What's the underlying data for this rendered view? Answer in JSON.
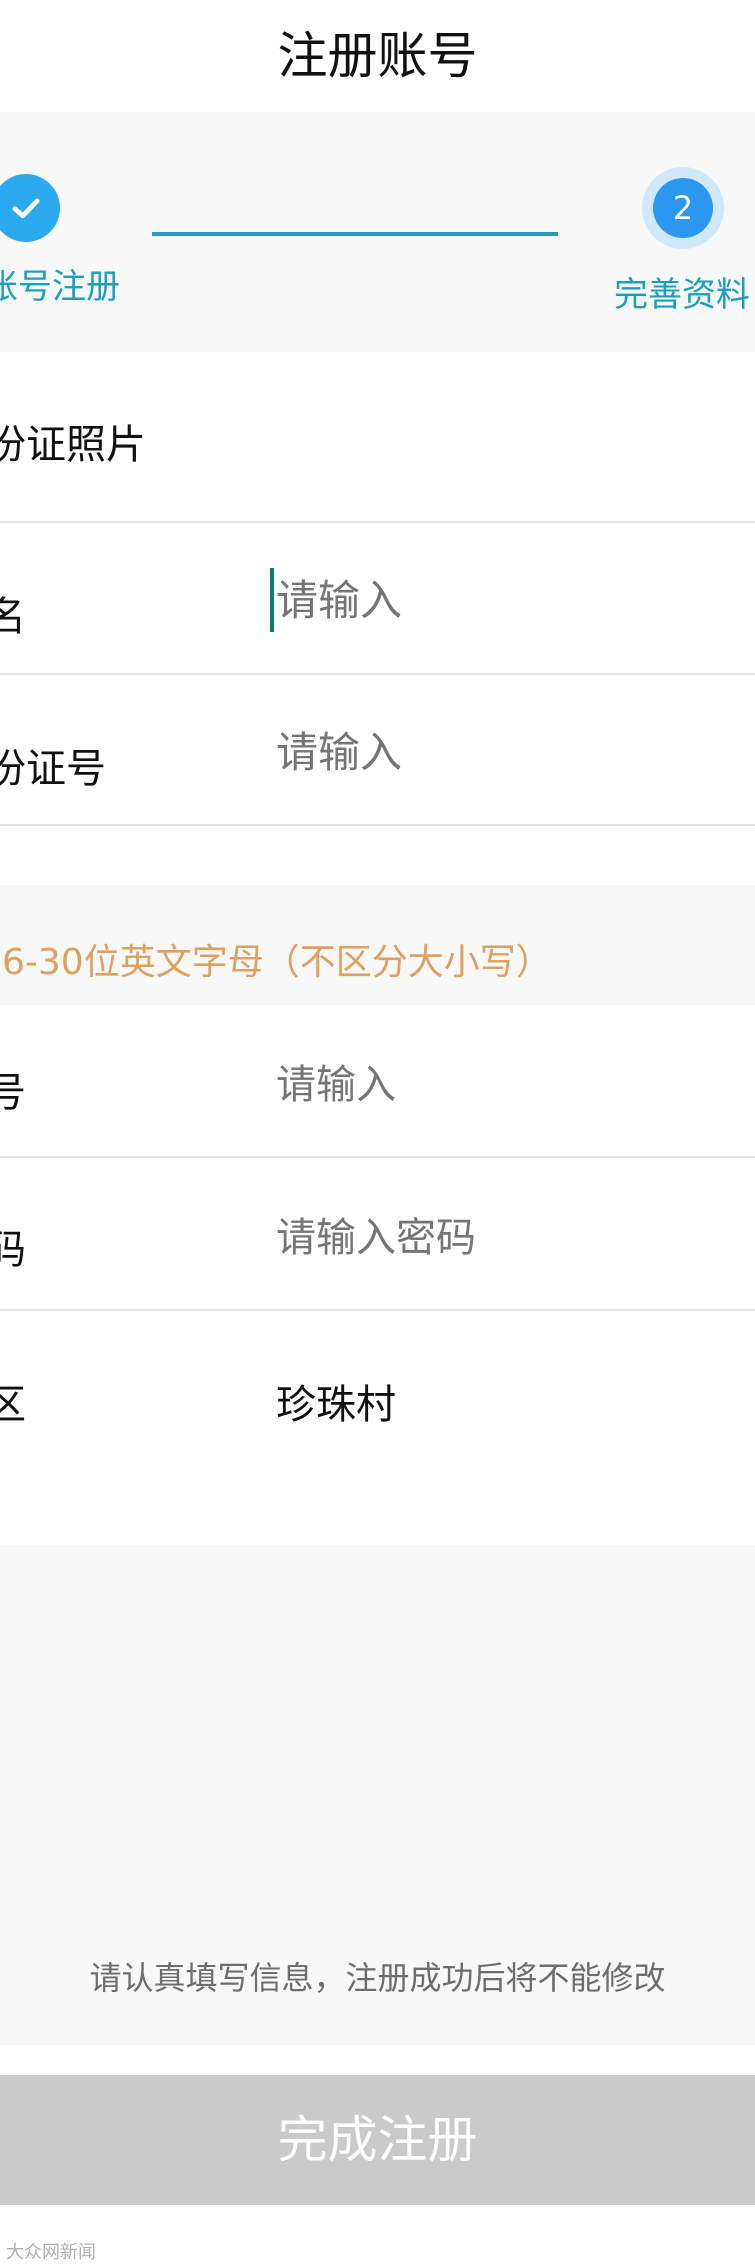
{
  "header": {
    "title": "注册账号"
  },
  "steps": {
    "step1": {
      "label": "账号注册",
      "icon": "check-icon"
    },
    "step2": {
      "number": "2",
      "label": "完善资料"
    }
  },
  "form": {
    "id_photo": {
      "label": "份证照片"
    },
    "name": {
      "label": "名",
      "placeholder": "请输入"
    },
    "id_number": {
      "label": "份证号",
      "placeholder": "请输入"
    },
    "account_hint": "6-30位英文字母（不区分大小写）",
    "account": {
      "label": "号",
      "placeholder": "请输入"
    },
    "password": {
      "label": "码",
      "placeholder": "请输入密码"
    },
    "area": {
      "label": "区",
      "value": "珍珠村"
    }
  },
  "notice": "请认真填写信息，注册成功后将不能修改",
  "submit_label": "完成注册",
  "watermark": "大众网新闻",
  "colors": {
    "accent": "#1aa0b8",
    "step_blue": "#2b97ef",
    "hint": "#e0a060",
    "button_disabled": "#cacaca"
  }
}
